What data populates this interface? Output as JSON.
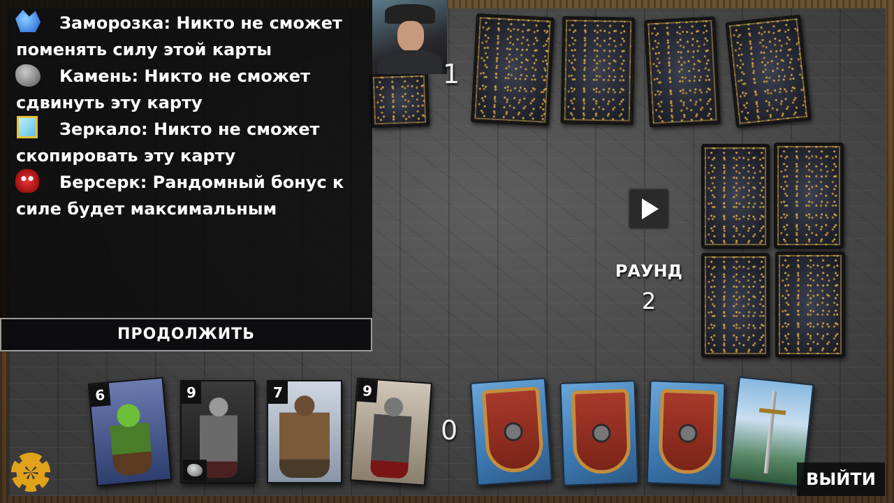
{
  "tooltip": {
    "rows": [
      {
        "icon": "ice-crystal-icon",
        "line1": "Заморозка: Никто не сможет",
        "line2": "поменять силу этой карты"
      },
      {
        "icon": "stone-icon",
        "line1": "Камень: Никто не сможет",
        "line2": "сдвинуть эту карту"
      },
      {
        "icon": "mirror-icon",
        "line1": "Зеркало: Никто не сможет",
        "line2": "скопировать эту карту"
      },
      {
        "icon": "berserk-mask-icon",
        "line1": "Берсерк: Рандомный бонус к",
        "line2": "силе будет максимальным"
      }
    ],
    "continue_label": "ПРОДОЛЖИТЬ"
  },
  "opponent": {
    "score": "1",
    "hand_count": 4
  },
  "player": {
    "score": "0"
  },
  "round": {
    "label": "РАУНД",
    "number": "2"
  },
  "hand": [
    {
      "power": "6",
      "art": "goblin"
    },
    {
      "power": "9",
      "art": "knight",
      "modifier_icon": "stone-icon"
    },
    {
      "power": "7",
      "art": "werewolf"
    },
    {
      "power": "9",
      "art": "knight"
    }
  ],
  "specials": [
    "shield",
    "shield",
    "shield",
    "sword"
  ],
  "exit_label": "ВЫЙТИ",
  "colors": {
    "accent": "#e0a21a",
    "tooltip_bg": "#08080a"
  }
}
